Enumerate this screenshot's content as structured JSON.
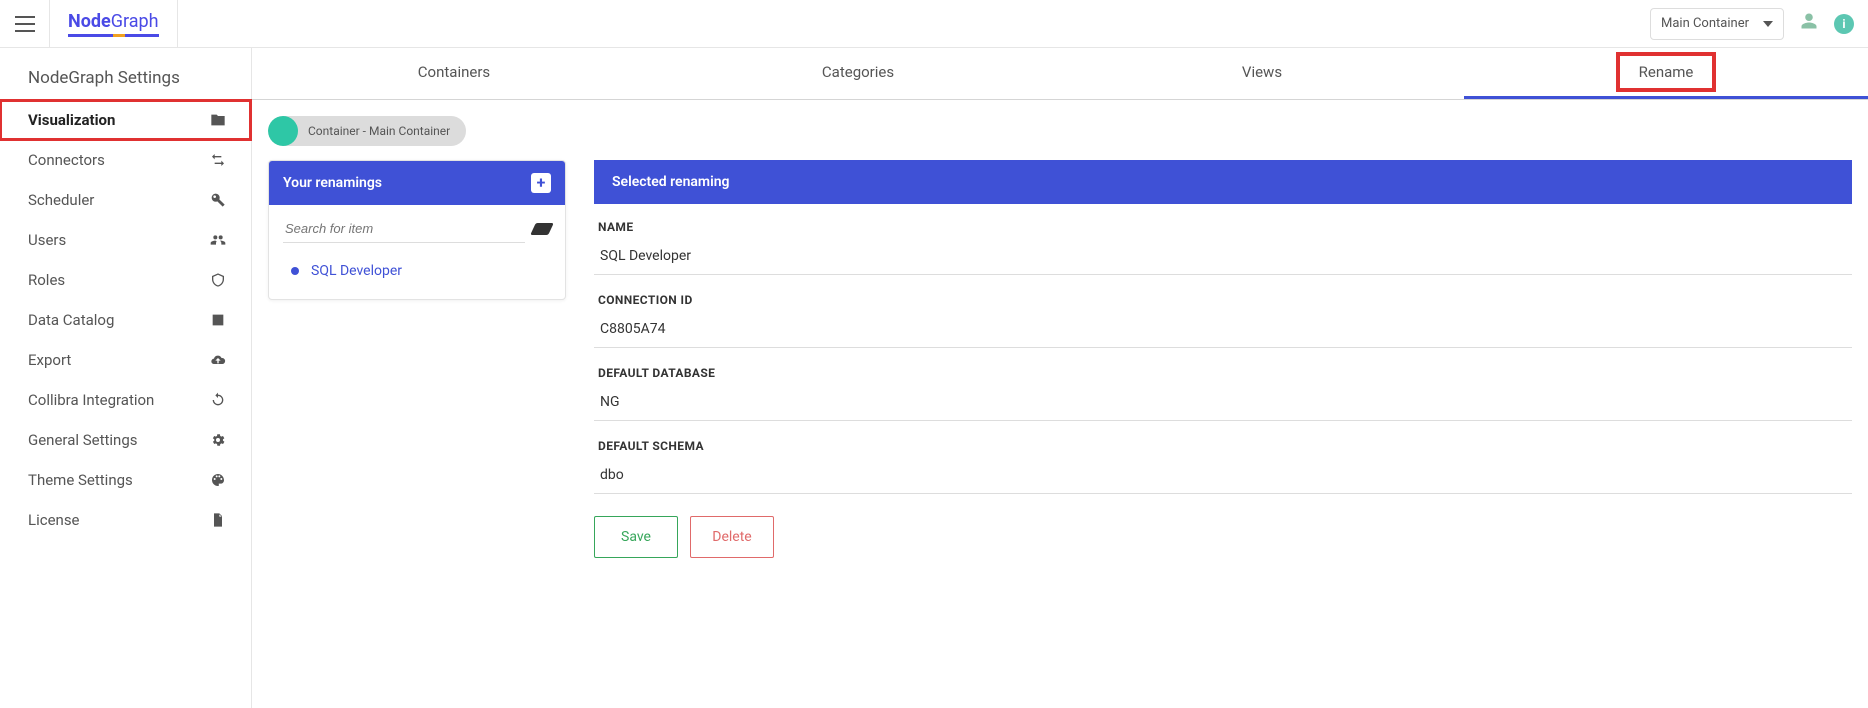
{
  "logo": {
    "left": "Node",
    "right": "Graph"
  },
  "topbar": {
    "container_selector": "Main Container"
  },
  "sidebar": {
    "title": "NodeGraph Settings",
    "items": [
      {
        "label": "Visualization",
        "icon": "folder"
      },
      {
        "label": "Connectors",
        "icon": "transfer"
      },
      {
        "label": "Scheduler",
        "icon": "wrench"
      },
      {
        "label": "Users",
        "icon": "users"
      },
      {
        "label": "Roles",
        "icon": "shield"
      },
      {
        "label": "Data Catalog",
        "icon": "tablet"
      },
      {
        "label": "Export",
        "icon": "cloud"
      },
      {
        "label": "Collibra Integration",
        "icon": "sync"
      },
      {
        "label": "General Settings",
        "icon": "gear"
      },
      {
        "label": "Theme Settings",
        "icon": "palette"
      },
      {
        "label": "License",
        "icon": "file"
      }
    ]
  },
  "tabs": [
    {
      "label": "Containers"
    },
    {
      "label": "Categories"
    },
    {
      "label": "Views"
    },
    {
      "label": "Rename"
    }
  ],
  "breadcrumb": "Container - Main Container",
  "left_panel": {
    "header": "Your renamings",
    "search_placeholder": "Search for item",
    "items": [
      "SQL Developer"
    ]
  },
  "right_panel": {
    "header": "Selected renaming",
    "fields": {
      "name": {
        "label": "NAME",
        "value": "SQL Developer"
      },
      "conn": {
        "label": "CONNECTION ID",
        "value": "C8805A74"
      },
      "db": {
        "label": "DEFAULT DATABASE",
        "value": "NG"
      },
      "schema": {
        "label": "DEFAULT SCHEMA",
        "value": "dbo"
      }
    },
    "actions": {
      "save": "Save",
      "delete": "Delete"
    }
  }
}
